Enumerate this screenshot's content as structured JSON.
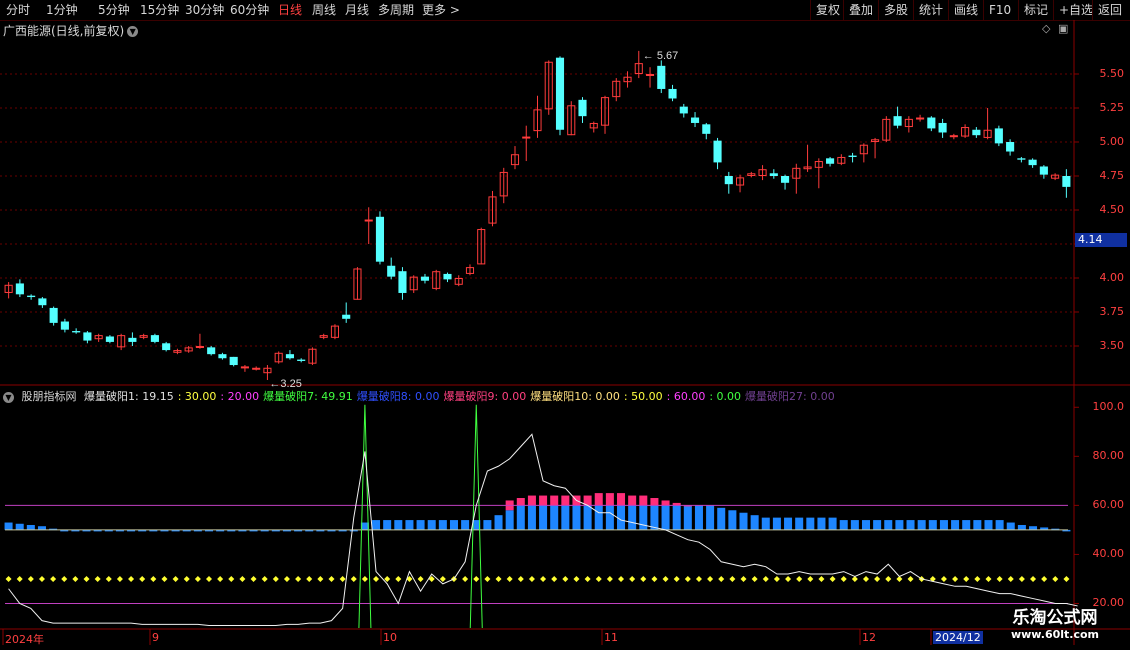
{
  "toolbar": {
    "periods": [
      "分时",
      "1分钟",
      "5分钟",
      "15分钟",
      "30分钟",
      "60分钟",
      "日线",
      "周线",
      "月线",
      "多周期",
      "更多 >"
    ],
    "active_period": "日线",
    "right_buttons": [
      "复权",
      "叠加",
      "多股",
      "统计",
      "画线",
      "F10",
      "标记",
      "+自选",
      "返回"
    ]
  },
  "chart_title": "广西能源(日线,前复权)",
  "chart_title_chevron": "chevron-down-icon",
  "current_price": "4.14",
  "high_marker": "5.67",
  "low_marker": "3.25",
  "indicator": {
    "name": "股朋指标网",
    "items": [
      {
        "text": "爆量破阳1: 19.15",
        "color": "#e0e0e0"
      },
      {
        "text": ": 30.00",
        "color": "#ffff40"
      },
      {
        "text": ": 20.00",
        "color": "#ff40ff"
      },
      {
        "text": "爆量破阳7: 49.91",
        "color": "#40ff40"
      },
      {
        "text": "爆量破阳8: 0.00",
        "color": "#3050ff"
      },
      {
        "text": "爆量破阳9: 0.00",
        "color": "#ff4080"
      },
      {
        "text": "爆量破阳10: 0.00",
        "color": "#ffe080"
      },
      {
        "text": ": 50.00",
        "color": "#ffff40"
      },
      {
        "text": ": 60.00",
        "color": "#ff40ff"
      },
      {
        "text": ": 0.00",
        "color": "#40ff40"
      },
      {
        "text": "爆量破阳27: 0.00",
        "color": "#704090"
      }
    ]
  },
  "colors": {
    "up": "#ff3c3c",
    "down": "#54ffff",
    "grid": "#6a0000",
    "bar_blue": "#1e86ff",
    "bar_pink": "#ff2e7a"
  },
  "chart_data": [
    {
      "type": "candlestick",
      "title": "广西能源(日线,前复权)",
      "y_ticks": [
        "5.50",
        "5.25",
        "5.00",
        "4.75",
        "4.50",
        "4.25",
        "4.00",
        "3.75",
        "3.50"
      ],
      "ylim": [
        3.25,
        5.75
      ],
      "candles": [
        [
          3.89,
          3.95,
          3.85,
          3.97
        ],
        [
          3.96,
          3.88,
          3.86,
          3.99
        ],
        [
          3.87,
          3.86,
          3.84,
          3.88
        ],
        [
          3.85,
          3.8,
          3.78,
          3.86
        ],
        [
          3.78,
          3.67,
          3.65,
          3.79
        ],
        [
          3.68,
          3.62,
          3.6,
          3.7
        ],
        [
          3.61,
          3.6,
          3.59,
          3.63
        ],
        [
          3.6,
          3.54,
          3.52,
          3.61
        ],
        [
          3.55,
          3.58,
          3.53,
          3.59
        ],
        [
          3.57,
          3.53,
          3.52,
          3.58
        ],
        [
          3.49,
          3.58,
          3.47,
          3.59
        ],
        [
          3.56,
          3.53,
          3.5,
          3.6
        ],
        [
          3.56,
          3.58,
          3.55,
          3.59
        ],
        [
          3.58,
          3.53,
          3.52,
          3.59
        ],
        [
          3.52,
          3.47,
          3.46,
          3.53
        ],
        [
          3.45,
          3.47,
          3.44,
          3.48
        ],
        [
          3.46,
          3.49,
          3.45,
          3.5
        ],
        [
          3.49,
          3.5,
          3.48,
          3.59
        ],
        [
          3.49,
          3.44,
          3.43,
          3.5
        ],
        [
          3.44,
          3.41,
          3.4,
          3.45
        ],
        [
          3.42,
          3.36,
          3.35,
          3.42
        ],
        [
          3.35,
          3.35,
          3.31,
          3.36
        ],
        [
          3.34,
          3.34,
          3.32,
          3.35
        ],
        [
          3.3,
          3.34,
          3.25,
          3.36
        ],
        [
          3.38,
          3.45,
          3.37,
          3.46
        ],
        [
          3.44,
          3.41,
          3.4,
          3.47
        ],
        [
          3.4,
          3.39,
          3.38,
          3.41
        ],
        [
          3.37,
          3.48,
          3.36,
          3.49
        ],
        [
          3.56,
          3.58,
          3.55,
          3.59
        ],
        [
          3.56,
          3.65,
          3.55,
          3.66
        ],
        [
          3.73,
          3.7,
          3.67,
          3.82
        ],
        [
          3.84,
          4.07,
          3.84,
          4.08
        ],
        [
          4.42,
          4.43,
          4.25,
          4.52
        ],
        [
          4.45,
          4.12,
          4.1,
          4.49
        ],
        [
          4.09,
          4.01,
          3.99,
          4.15
        ],
        [
          4.05,
          3.89,
          3.84,
          4.08
        ],
        [
          3.91,
          4.01,
          3.89,
          4.02
        ],
        [
          4.01,
          3.98,
          3.96,
          4.03
        ],
        [
          3.92,
          4.05,
          3.91,
          4.06
        ],
        [
          4.03,
          3.99,
          3.97,
          4.04
        ],
        [
          3.95,
          4.0,
          3.94,
          4.02
        ],
        [
          4.03,
          4.08,
          4.02,
          4.1
        ],
        [
          4.1,
          4.36,
          4.1,
          4.37
        ],
        [
          4.4,
          4.6,
          4.38,
          4.64
        ],
        [
          4.6,
          4.78,
          4.55,
          4.81
        ],
        [
          4.83,
          4.91,
          4.8,
          4.97
        ],
        [
          5.04,
          5.04,
          4.86,
          5.12
        ],
        [
          5.08,
          5.24,
          5.03,
          5.34
        ],
        [
          5.24,
          5.59,
          5.2,
          5.6
        ],
        [
          5.62,
          5.09,
          5.05,
          5.63
        ],
        [
          5.05,
          5.27,
          5.05,
          5.3
        ],
        [
          5.31,
          5.19,
          5.14,
          5.33
        ],
        [
          5.1,
          5.14,
          5.07,
          5.15
        ],
        [
          5.12,
          5.33,
          5.06,
          5.34
        ],
        [
          5.33,
          5.45,
          5.3,
          5.47
        ],
        [
          5.44,
          5.48,
          5.4,
          5.52
        ],
        [
          5.5,
          5.58,
          5.47,
          5.67
        ],
        [
          5.5,
          5.5,
          5.4,
          5.55
        ],
        [
          5.56,
          5.39,
          5.36,
          5.6
        ],
        [
          5.39,
          5.32,
          5.3,
          5.42
        ],
        [
          5.26,
          5.21,
          5.18,
          5.28
        ],
        [
          5.18,
          5.14,
          5.11,
          5.22
        ],
        [
          5.13,
          5.06,
          5.02,
          5.14
        ],
        [
          5.01,
          4.85,
          4.8,
          5.03
        ],
        [
          4.75,
          4.69,
          4.62,
          4.78
        ],
        [
          4.68,
          4.74,
          4.63,
          4.76
        ],
        [
          4.75,
          4.77,
          4.74,
          4.78
        ],
        [
          4.75,
          4.8,
          4.72,
          4.83
        ],
        [
          4.77,
          4.75,
          4.73,
          4.8
        ],
        [
          4.75,
          4.7,
          4.65,
          4.76
        ],
        [
          4.73,
          4.81,
          4.62,
          4.84
        ],
        [
          4.8,
          4.82,
          4.78,
          4.98
        ],
        [
          4.81,
          4.86,
          4.66,
          4.88
        ],
        [
          4.88,
          4.84,
          4.82,
          4.89
        ],
        [
          4.84,
          4.89,
          4.83,
          4.91
        ],
        [
          4.9,
          4.89,
          4.85,
          4.92
        ],
        [
          4.91,
          4.98,
          4.85,
          4.99
        ],
        [
          5.0,
          5.02,
          4.88,
          5.03
        ],
        [
          5.01,
          5.17,
          5.0,
          5.19
        ],
        [
          5.19,
          5.12,
          5.1,
          5.26
        ],
        [
          5.11,
          5.17,
          5.07,
          5.19
        ],
        [
          5.17,
          5.18,
          5.15,
          5.2
        ],
        [
          5.18,
          5.1,
          5.08,
          5.19
        ],
        [
          5.14,
          5.07,
          5.03,
          5.17
        ],
        [
          5.04,
          5.05,
          5.02,
          5.06
        ],
        [
          5.04,
          5.11,
          5.03,
          5.13
        ],
        [
          5.09,
          5.05,
          5.03,
          5.11
        ],
        [
          5.03,
          5.09,
          5.02,
          5.25
        ],
        [
          5.1,
          4.99,
          4.97,
          5.12
        ],
        [
          5.0,
          4.93,
          4.9,
          5.02
        ],
        [
          4.88,
          4.87,
          4.85,
          4.89
        ],
        [
          4.87,
          4.83,
          4.81,
          4.88
        ],
        [
          4.82,
          4.76,
          4.73,
          4.83
        ],
        [
          4.73,
          4.76,
          4.72,
          4.77
        ],
        [
          4.75,
          4.67,
          4.59,
          4.8
        ]
      ]
    },
    {
      "type": "indicator",
      "title": "股朋指标网",
      "y_ticks": [
        "100.0",
        "80.00",
        "60.00",
        "40.00",
        "20.00"
      ],
      "ylim": [
        10,
        105
      ],
      "white_line": [
        26,
        20,
        18,
        13,
        12,
        12,
        12,
        12,
        12,
        12,
        12,
        12,
        11.5,
        11.5,
        11.5,
        11.5,
        11.5,
        11.5,
        11,
        11,
        11,
        11,
        11,
        11,
        11,
        11.5,
        11.5,
        12,
        12,
        13,
        18,
        55,
        82,
        33,
        28,
        20,
        33,
        25,
        32,
        28,
        30,
        37,
        60,
        74,
        76,
        79,
        84,
        89,
        70,
        68,
        67,
        62,
        60,
        57,
        57,
        54,
        53,
        52,
        51,
        50,
        48,
        46,
        45,
        42,
        37,
        36,
        35,
        36,
        35,
        32,
        32,
        33,
        32,
        32,
        32,
        33,
        31,
        33,
        32,
        36,
        31,
        33,
        30,
        29,
        28,
        27,
        27,
        26,
        25,
        24,
        24,
        23,
        22,
        21,
        20,
        20,
        19
      ],
      "green_spikes": [
        32,
        42
      ],
      "blue_bars": [
        53,
        52.5,
        52,
        51.5,
        50.5,
        50,
        50,
        50,
        50,
        50,
        50,
        50,
        50,
        50,
        50,
        50,
        50,
        50,
        50,
        50,
        50,
        50,
        50,
        50,
        50,
        50,
        50,
        50,
        50,
        50,
        50,
        50,
        53,
        54,
        54,
        54,
        54,
        54,
        54,
        54,
        54,
        54,
        54,
        54,
        56,
        58,
        60,
        60,
        60,
        60,
        60,
        60,
        60,
        60,
        60,
        60,
        60,
        60,
        60,
        60,
        60,
        60,
        60,
        60,
        59,
        58,
        57,
        56,
        55,
        55,
        55,
        55,
        55,
        55,
        55,
        54,
        54,
        54,
        54,
        54,
        54,
        54,
        54,
        54,
        54,
        54,
        54,
        54,
        54,
        54,
        53,
        52,
        51.5,
        51,
        50.5,
        50
      ],
      "pink_bars": [
        0,
        0,
        0,
        0,
        0,
        0,
        0,
        0,
        0,
        0,
        0,
        0,
        0,
        0,
        0,
        0,
        0,
        0,
        0,
        0,
        0,
        0,
        0,
        0,
        0,
        0,
        0,
        0,
        0,
        0,
        0,
        0,
        0,
        0,
        0,
        0,
        0,
        0,
        0,
        0,
        0,
        0,
        0,
        0,
        0,
        62,
        63,
        64,
        64,
        64,
        64,
        64,
        64,
        65,
        65,
        65,
        64,
        64,
        63,
        62,
        61,
        60,
        0,
        0,
        0,
        0,
        0,
        0,
        0,
        0,
        0,
        0,
        0,
        0,
        0,
        0,
        0,
        0,
        0,
        0,
        0,
        0,
        0,
        0,
        0,
        0,
        0,
        0,
        0,
        0,
        0,
        0,
        0,
        0,
        0,
        0
      ],
      "yellow_dots_level": 30,
      "magenta_lines": [
        60,
        20
      ],
      "white_flat_line": 50
    }
  ],
  "x_labels": [
    "2024年",
    "9",
    "10",
    "11",
    "12",
    "2024/12"
  ]
}
